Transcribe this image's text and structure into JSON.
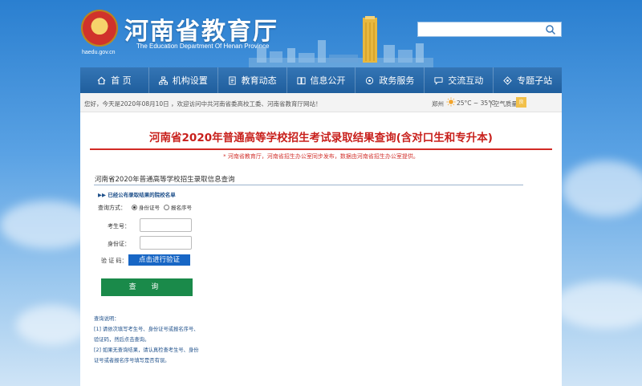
{
  "header": {
    "site_title": "河南省教育厅",
    "site_subtitle": "The Education Department Of Henan Province",
    "emblem_url": "haedu.gov.cn",
    "search": {
      "placeholder": ""
    }
  },
  "nav": {
    "items": [
      {
        "label": "首 页",
        "icon": "home-icon"
      },
      {
        "label": "机构设置",
        "icon": "org-chart-icon"
      },
      {
        "label": "教育动态",
        "icon": "document-icon"
      },
      {
        "label": "信息公开",
        "icon": "info-book-icon"
      },
      {
        "label": "政务服务",
        "icon": "service-icon"
      },
      {
        "label": "交流互动",
        "icon": "chat-icon"
      },
      {
        "label": "专题子站",
        "icon": "topic-icon"
      }
    ]
  },
  "infobar": {
    "welcome": "您好，今天是2020年08月10日 ，欢迎访问中共河南省委高校工委、河南省教育厅网站！",
    "city": "郑州",
    "temperature": "25°C ~ 35°C",
    "air_quality_label": "| 空气质量：",
    "air_quality_value": "良"
  },
  "page": {
    "title": "河南省2020年普通高等学校招生考试录取结果查询(含对口生和专升本)",
    "source_note": "* 河南省教育厅，河南省招生办公室同步发布，数据由河南省招生办公室提供。"
  },
  "form": {
    "title": "河南省2020年普通高等学校招生录取信息查询",
    "list_link": "▶▶ 已经公布录取结果的院校名单",
    "query_mode_label": "查询方式：",
    "option_id_card": "身份证号",
    "option_reg_no": "报名序号",
    "exam_no_label": "考生号：",
    "exam_no_value": "",
    "id_card_label": "身份证：",
    "id_card_value": "",
    "captcha_label": "验 证 码：",
    "verify_button": "点击进行验证",
    "query_button": "查 询"
  },
  "notes": {
    "heading": "查询说明：",
    "line1": "[1] 请依次填写考生号、身份证号或报名序号、",
    "line2": "验证码，然后点击查询。",
    "line3": "[2] 如果无查询结果，请认真检查考生号、身份",
    "line4": "证号或者报名序号填写是否有误。"
  },
  "colors": {
    "nav_bg": "#1f5e9d",
    "title_red": "#c8201c",
    "verify_blue": "#1766c5",
    "query_green": "#1a8a4a"
  }
}
